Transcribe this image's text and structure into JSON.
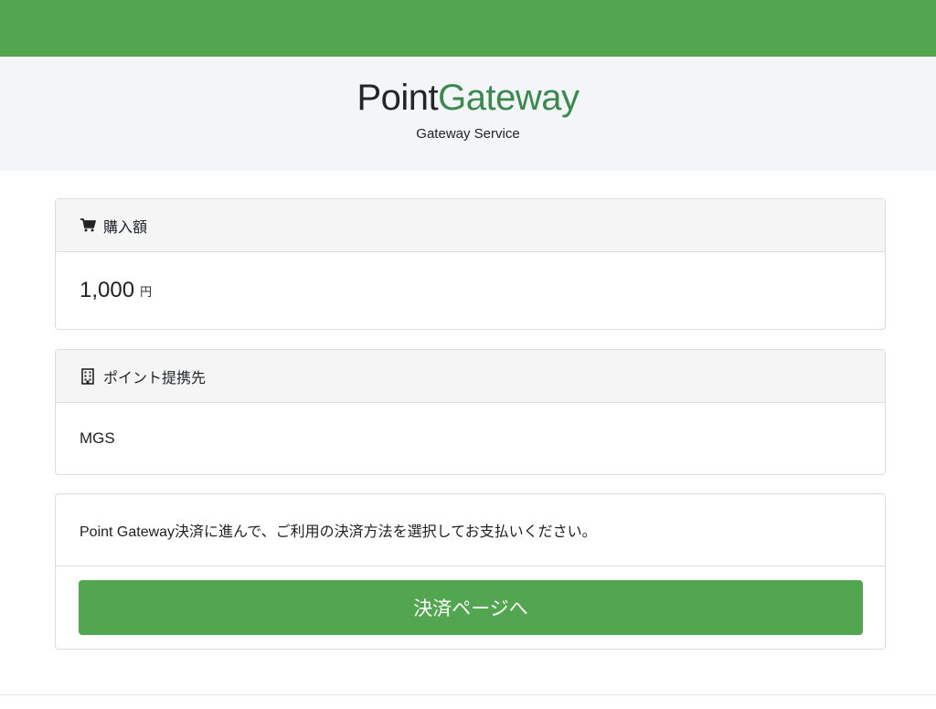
{
  "brand": {
    "name_part1": "Point",
    "name_part2": "Gateway",
    "subtitle": "Gateway Service",
    "accent_color": "#53a650",
    "logo_green": "#3a8a4f"
  },
  "purchase": {
    "header_icon": "cart-icon",
    "header_label": "購入額",
    "amount": "1,000",
    "unit": "円"
  },
  "partner": {
    "header_icon": "building-icon",
    "header_label": "ポイント提携先",
    "value": "MGS"
  },
  "payment": {
    "description": "Point Gateway決済に進んで、ご利用の決済方法を選択してお支払いください。",
    "button_label": "決済ページへ"
  }
}
